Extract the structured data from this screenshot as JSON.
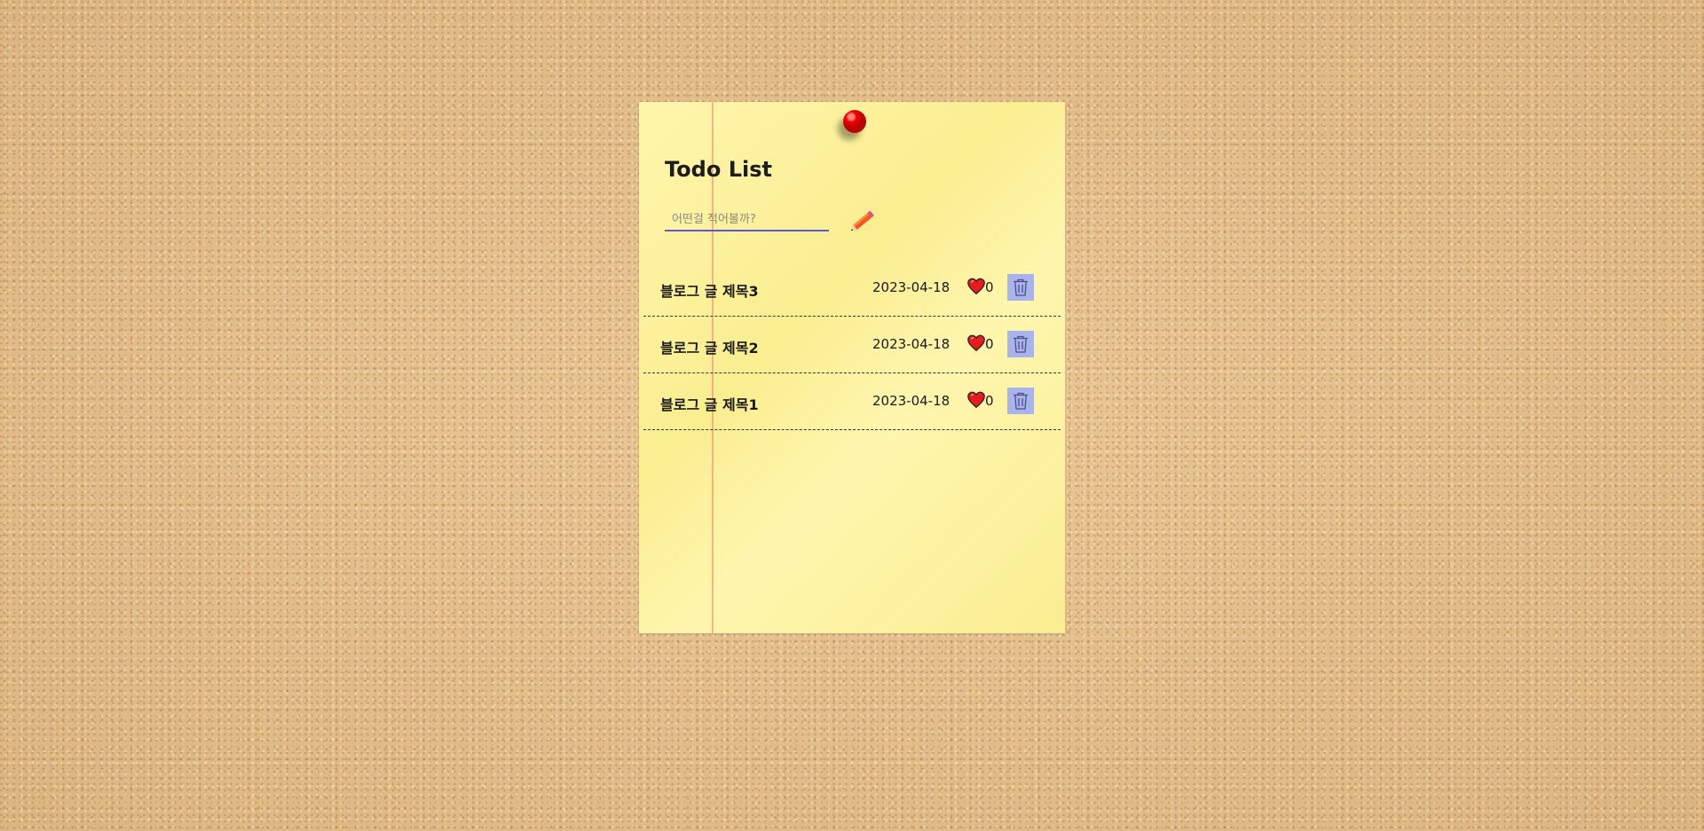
{
  "app": {
    "title": "Todo List"
  },
  "input": {
    "placeholder": "어떤걸 적어볼까?",
    "value": "",
    "submit_icon": "pencil-icon"
  },
  "items": [
    {
      "title": "블로그 글 제목3",
      "date": "2023-04-18",
      "likes": "0"
    },
    {
      "title": "블로그 글 제목2",
      "date": "2023-04-18",
      "likes": "0"
    },
    {
      "title": "블로그 글 제목1",
      "date": "2023-04-18",
      "likes": "0"
    }
  ],
  "icons": {
    "like": "heart-icon",
    "delete": "trash-icon",
    "pin": "pushpin-icon"
  },
  "colors": {
    "note": "#fff49a",
    "pin": "#f40000",
    "input_underline": "#5b5bd6",
    "delete_button": "#a9b4ee",
    "heart": "#e81c1c"
  }
}
